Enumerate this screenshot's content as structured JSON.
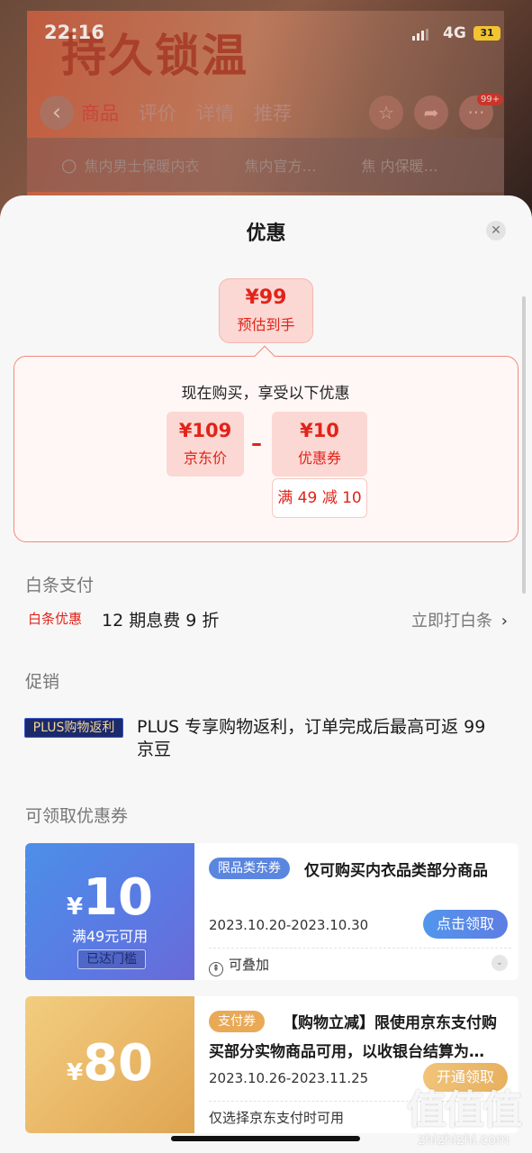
{
  "status_bar": {
    "time": "22:16",
    "network": "4G",
    "battery": "31"
  },
  "background": {
    "banner_title": "持久锁温",
    "tabs": [
      "商品",
      "评价",
      "详情",
      "推荐"
    ],
    "badge": "99+",
    "search_items": [
      "焦内男士保暖内衣",
      "焦内官方…",
      "焦 内保暖…"
    ]
  },
  "sheet": {
    "title": "优惠",
    "close_icon": "close-icon",
    "estimate": {
      "price": "¥99",
      "label": "预估到手"
    },
    "calc": {
      "heading": "现在购买，享受以下优惠",
      "jd_price": {
        "value": "¥109",
        "label": "京东价"
      },
      "operator": "–",
      "coupon": {
        "value": "¥10",
        "label": "优惠券"
      },
      "condition": "满 49 减 10"
    },
    "baitiao": {
      "section_title": "白条支付",
      "tag": "白条优惠",
      "text": "12 期息费 9 折",
      "link": "立即打白条",
      "link_icon": "chevron-right-icon"
    },
    "promo": {
      "section_title": "促销",
      "tag": "PLUS购物返利",
      "text": "PLUS 专享购物返利，订单完成后最高可返 99 京豆"
    },
    "coupons": {
      "section_title": "可领取优惠券",
      "items": [
        {
          "currency": "¥",
          "amount": "10",
          "min_req": "满49元可用",
          "reached": "已达门槛",
          "tag": "限品类东券",
          "desc": "仅可购买内衣品类部分商品",
          "date": "2023.10.20-2023.10.30",
          "button": "点击领取",
          "footer": "可叠加",
          "color": "#5b86df"
        },
        {
          "currency": "¥",
          "amount": "80",
          "tag": "支付券",
          "desc": "【购物立减】限使用京东支付购买部分实物商品可用，以收银台结算为…",
          "date": "2023.10.26-2023.11.25",
          "button": "开通领取",
          "footer": "仅选择京东支付时可用",
          "color": "#e9a956"
        }
      ]
    }
  },
  "watermark": {
    "big": "值值值",
    "small": "zhizhizhi.com"
  },
  "colors": {
    "accent_red": "#e2231a",
    "sheet_bg": "#f7f7f7"
  }
}
